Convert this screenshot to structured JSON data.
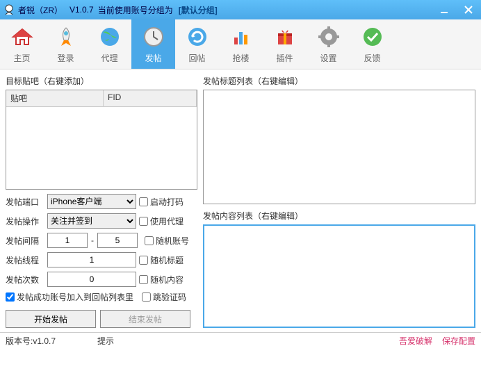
{
  "titlebar": {
    "app": "者锐（ZR）",
    "version": "V1.0.7",
    "group_prefix": "当前使用账号分组为",
    "group": "[默认分组]"
  },
  "toolbar": {
    "items": [
      {
        "key": "home",
        "label": "主页"
      },
      {
        "key": "login",
        "label": "登录"
      },
      {
        "key": "proxy",
        "label": "代理"
      },
      {
        "key": "post",
        "label": "发帖"
      },
      {
        "key": "reply",
        "label": "回帖"
      },
      {
        "key": "grab",
        "label": "抢楼"
      },
      {
        "key": "plugin",
        "label": "插件"
      },
      {
        "key": "settings",
        "label": "设置"
      },
      {
        "key": "feedback",
        "label": "反馈"
      }
    ],
    "active": "post"
  },
  "left": {
    "target_label": "目标贴吧（右键添加）",
    "col_tieba": "贴吧",
    "col_fid": "FID",
    "port_label": "发帖端口",
    "port_value": "iPhone客户端",
    "chk_dama": "启动打码",
    "op_label": "发帖操作",
    "op_value": "关注并签到",
    "chk_proxy": "使用代理",
    "interval_label": "发帖间隔",
    "interval_from": "1",
    "interval_to": "5",
    "chk_randacc": "随机账号",
    "thread_label": "发帖线程",
    "thread_value": "1",
    "chk_randtitle": "随机标题",
    "count_label": "发帖次数",
    "count_value": "0",
    "chk_randcontent": "随机内容",
    "chk_addreply": "发帖成功账号加入到回帖列表里",
    "chk_skipcode": "跳验证码",
    "btn_start": "开始发帖",
    "btn_stop": "结束发帖"
  },
  "right": {
    "titles_label": "发帖标题列表（右键编辑）",
    "content_label": "发帖内容列表（右键编辑）"
  },
  "status": {
    "version_label": "版本号:v1.0.7",
    "tip": "提示",
    "link1": "吾爱破解",
    "link2": "保存配置"
  }
}
